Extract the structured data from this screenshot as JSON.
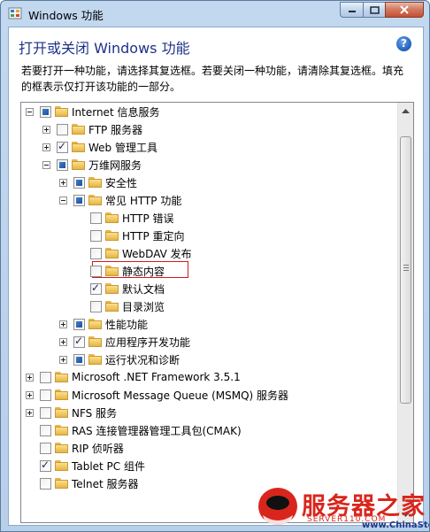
{
  "window": {
    "title": "Windows 功能",
    "heading": "打开或关闭 Windows 功能",
    "description": "若要打开一种功能，请选择其复选框。若要关闭一种功能，请清除其复选框。填充的框表示仅打开该功能的一部分。",
    "help_glyph": "?",
    "highlight_color": "#d8171d"
  },
  "tree": [
    {
      "label": "Internet 信息服务",
      "state": "partial",
      "expander": "minus"
    },
    {
      "label": "FTP 服务器",
      "state": "unchecked",
      "expander": "plus"
    },
    {
      "label": "Web 管理工具",
      "state": "checked",
      "expander": "plus"
    },
    {
      "label": "万维网服务",
      "state": "partial",
      "expander": "minus"
    },
    {
      "label": "安全性",
      "state": "partial",
      "expander": "plus"
    },
    {
      "label": "常见 HTTP 功能",
      "state": "partial",
      "expander": "minus"
    },
    {
      "label": "HTTP 错误",
      "state": "unchecked",
      "expander": "none"
    },
    {
      "label": "HTTP 重定向",
      "state": "unchecked",
      "expander": "none"
    },
    {
      "label": "WebDAV 发布",
      "state": "unchecked",
      "expander": "none"
    },
    {
      "label": "静态内容",
      "state": "unchecked",
      "expander": "none"
    },
    {
      "label": "默认文档",
      "state": "checked",
      "expander": "none"
    },
    {
      "label": "目录浏览",
      "state": "unchecked",
      "expander": "none"
    },
    {
      "label": "性能功能",
      "state": "partial",
      "expander": "plus"
    },
    {
      "label": "应用程序开发功能",
      "state": "checked",
      "expander": "plus"
    },
    {
      "label": "运行状况和诊断",
      "state": "partial",
      "expander": "plus"
    },
    {
      "label": "Microsoft .NET Framework 3.5.1",
      "state": "unchecked",
      "expander": "plus"
    },
    {
      "label": "Microsoft Message Queue (MSMQ) 服务器",
      "state": "unchecked",
      "expander": "plus"
    },
    {
      "label": "NFS 服务",
      "state": "unchecked",
      "expander": "plus"
    },
    {
      "label": "RAS 连接管理器管理工具包(CMAK)",
      "state": "unchecked",
      "expander": "none"
    },
    {
      "label": "RIP 侦听器",
      "state": "unchecked",
      "expander": "none"
    },
    {
      "label": "Tablet PC 组件",
      "state": "checked",
      "expander": "none"
    },
    {
      "label": "Telnet 服务器",
      "state": "unchecked",
      "expander": "none"
    }
  ],
  "watermark": {
    "title": "服务器之家",
    "url1": "SERVER110.COM",
    "url2": "www.ChinaStor.com"
  }
}
